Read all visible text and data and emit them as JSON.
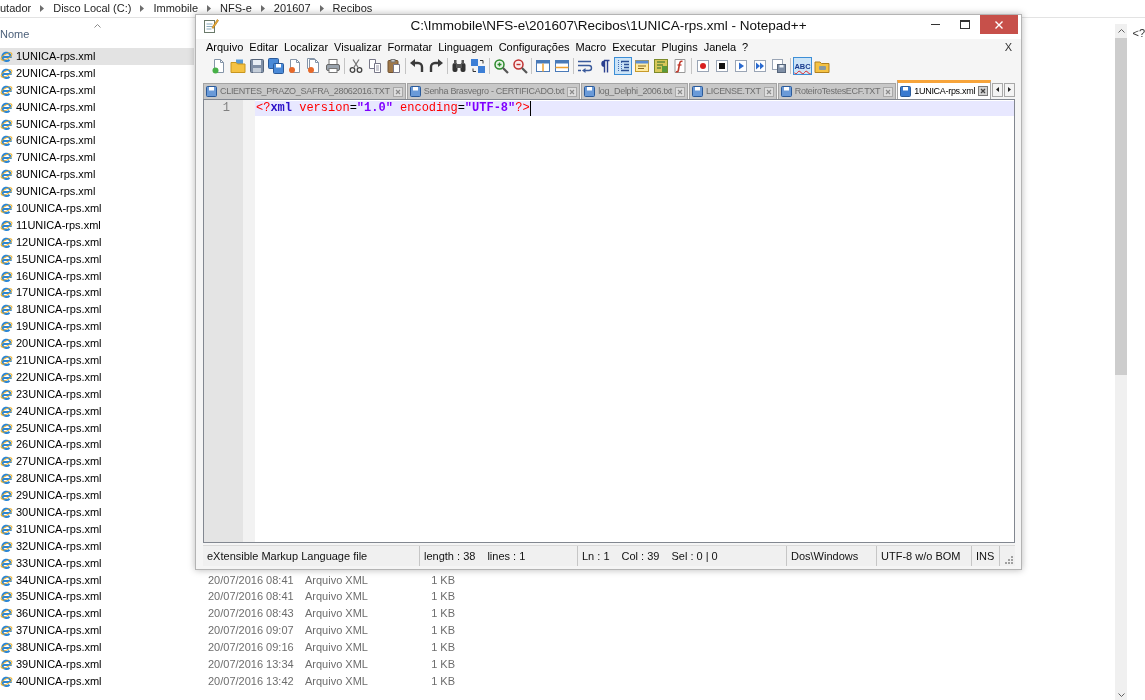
{
  "explorer": {
    "breadcrumb": [
      "utador",
      "Disco Local (C:)",
      "Immobile",
      "NFS-e",
      "201607",
      "Recibos"
    ],
    "columns": [
      {
        "label": "Nome",
        "sorted": true
      }
    ],
    "files": [
      {
        "name": "1UNICA-rps.xml",
        "selected": true
      },
      {
        "name": "2UNICA-rps.xml",
        "selected": false
      },
      {
        "name": "3UNICA-rps.xml",
        "selected": false
      },
      {
        "name": "4UNICA-rps.xml",
        "selected": false
      },
      {
        "name": "5UNICA-rps.xml",
        "selected": false
      },
      {
        "name": "6UNICA-rps.xml",
        "selected": false
      },
      {
        "name": "7UNICA-rps.xml",
        "selected": false
      },
      {
        "name": "8UNICA-rps.xml",
        "selected": false
      },
      {
        "name": "9UNICA-rps.xml",
        "selected": false
      },
      {
        "name": "10UNICA-rps.xml",
        "selected": false
      },
      {
        "name": "11UNICA-rps.xml",
        "selected": false
      },
      {
        "name": "12UNICA-rps.xml",
        "selected": false
      },
      {
        "name": "15UNICA-rps.xml",
        "selected": false
      },
      {
        "name": "16UNICA-rps.xml",
        "selected": false
      },
      {
        "name": "17UNICA-rps.xml",
        "selected": false
      },
      {
        "name": "18UNICA-rps.xml",
        "selected": false
      },
      {
        "name": "19UNICA-rps.xml",
        "selected": false
      },
      {
        "name": "20UNICA-rps.xml",
        "selected": false
      },
      {
        "name": "21UNICA-rps.xml",
        "selected": false
      },
      {
        "name": "22UNICA-rps.xml",
        "selected": false
      },
      {
        "name": "23UNICA-rps.xml",
        "selected": false
      },
      {
        "name": "24UNICA-rps.xml",
        "selected": false
      },
      {
        "name": "25UNICA-rps.xml",
        "selected": false
      },
      {
        "name": "26UNICA-rps.xml",
        "selected": false
      },
      {
        "name": "27UNICA-rps.xml",
        "selected": false
      },
      {
        "name": "28UNICA-rps.xml",
        "selected": false
      },
      {
        "name": "29UNICA-rps.xml",
        "selected": false
      },
      {
        "name": "30UNICA-rps.xml",
        "selected": false
      },
      {
        "name": "31UNICA-rps.xml",
        "selected": false
      },
      {
        "name": "32UNICA-rps.xml",
        "selected": false
      },
      {
        "name": "33UNICA-rps.xml",
        "selected": false
      },
      {
        "name": "34UNICA-rps.xml",
        "selected": false,
        "column_2": "20/07/2016 08:41",
        "column_3": "Arquivo XML",
        "column_4": "1 KB"
      },
      {
        "name": "35UNICA-rps.xml",
        "selected": false,
        "column_2": "20/07/2016 08:41",
        "column_3": "Arquivo XML",
        "column_4": "1 KB"
      },
      {
        "name": "36UNICA-rps.xml",
        "selected": false,
        "column_2": "20/07/2016 08:43",
        "column_3": "Arquivo XML",
        "column_4": "1 KB"
      },
      {
        "name": "37UNICA-rps.xml",
        "selected": false,
        "column_2": "20/07/2016 09:07",
        "column_3": "Arquivo XML",
        "column_4": "1 KB"
      },
      {
        "name": "38UNICA-rps.xml",
        "selected": false,
        "column_2": "20/07/2016 09:16",
        "column_3": "Arquivo XML",
        "column_4": "1 KB"
      },
      {
        "name": "39UNICA-rps.xml",
        "selected": false,
        "column_2": "20/07/2016 13:34",
        "column_3": "Arquivo XML",
        "column_4": "1 KB"
      },
      {
        "name": "40UNICA-rps.xml",
        "selected": false,
        "column_2": "20/07/2016 13:42",
        "column_3": "Arquivo XML",
        "column_4": "1 KB"
      }
    ],
    "preview_text": "<?"
  },
  "notepad": {
    "title": "C:\\Immobile\\NFS-e\\201607\\Recibos\\1UNICA-rps.xml - Notepad++",
    "menu": [
      "Arquivo",
      "Editar",
      "Localizar",
      "Visualizar",
      "Formatar",
      "Linguagem",
      "Configurações",
      "Macro",
      "Executar",
      "Plugins",
      "Janela",
      "?"
    ],
    "menu_close": "X",
    "toolbar": [
      [
        {
          "kind": "icon",
          "on": false
        },
        {
          "kind": "icon",
          "on": false
        },
        {
          "kind": "icon",
          "on": false
        },
        {
          "kind": "icon",
          "on": false
        },
        {
          "kind": "icon",
          "on": false
        },
        {
          "kind": "icon",
          "on": false
        },
        {
          "kind": "icon",
          "on": false
        }
      ],
      [
        {
          "kind": "icon",
          "on": false
        },
        {
          "kind": "icon",
          "on": false
        },
        {
          "kind": "icon",
          "on": false
        }
      ],
      [
        {
          "kind": "icon",
          "on": false
        },
        {
          "kind": "icon",
          "on": false
        }
      ],
      [
        {
          "kind": "icon",
          "on": false
        },
        {
          "kind": "icon",
          "on": false
        }
      ],
      [
        {
          "kind": "icon",
          "on": false
        },
        {
          "kind": "icon",
          "on": false
        }
      ],
      [
        {
          "kind": "icon",
          "on": false
        },
        {
          "kind": "icon",
          "on": false
        }
      ],
      [
        {
          "kind": "icon",
          "on": false
        },
        {
          "kind": "icon",
          "on": false
        },
        {
          "kind": "icon",
          "on": true
        },
        {
          "kind": "icon",
          "on": false
        },
        {
          "kind": "icon",
          "on": false
        },
        {
          "kind": "icon",
          "on": false
        }
      ],
      [
        {
          "kind": "icon",
          "on": false
        },
        {
          "kind": "icon",
          "on": false
        },
        {
          "kind": "icon",
          "on": false
        },
        {
          "kind": "icon",
          "on": false
        },
        {
          "kind": "icon",
          "on": false
        }
      ],
      [
        {
          "kind": "text",
          "label": "ABC",
          "on": true
        },
        {
          "kind": "icon",
          "on": false
        }
      ]
    ],
    "tabs": [
      {
        "label": "CLIENTES_PRAZO_SAFRA_28062016.TXT",
        "selected": false
      },
      {
        "label": "Senha Brasvegro - CERTIFICADO.txt",
        "selected": false
      },
      {
        "label": "log_Delphi_2006.txt",
        "selected": false
      },
      {
        "label": "LICENSE.TXT",
        "selected": false
      },
      {
        "label": "RoteiroTestesECF.TXT",
        "selected": false
      },
      {
        "label": "1UNICA-rps.xml",
        "selected": true
      }
    ],
    "editor": {
      "lines": [
        {
          "number": "1",
          "current": true,
          "caret": true,
          "tokens": [
            {
              "kind": "delimiter",
              "text": "<?"
            },
            {
              "kind": "tag",
              "text": "xml"
            },
            {
              "kind": "attribute",
              "text": " version"
            },
            {
              "kind": "operator",
              "text": "="
            },
            {
              "kind": "value",
              "text": "\"1.0\""
            },
            {
              "kind": "attribute",
              "text": " encoding"
            },
            {
              "kind": "operator",
              "text": "="
            },
            {
              "kind": "value",
              "text": "\"UTF-8\""
            },
            {
              "kind": "delimiter",
              "text": "?>"
            }
          ]
        }
      ]
    },
    "status_bar": [
      [
        "eXtensible Markup Language file"
      ],
      [
        "length : 38",
        "lines : 1"
      ],
      [
        "Ln : 1",
        "Col : 39",
        "Sel : 0 | 0"
      ],
      [
        "Dos\\Windows"
      ],
      [
        "UTF-8 w/o BOM"
      ],
      [
        "INS"
      ]
    ]
  }
}
